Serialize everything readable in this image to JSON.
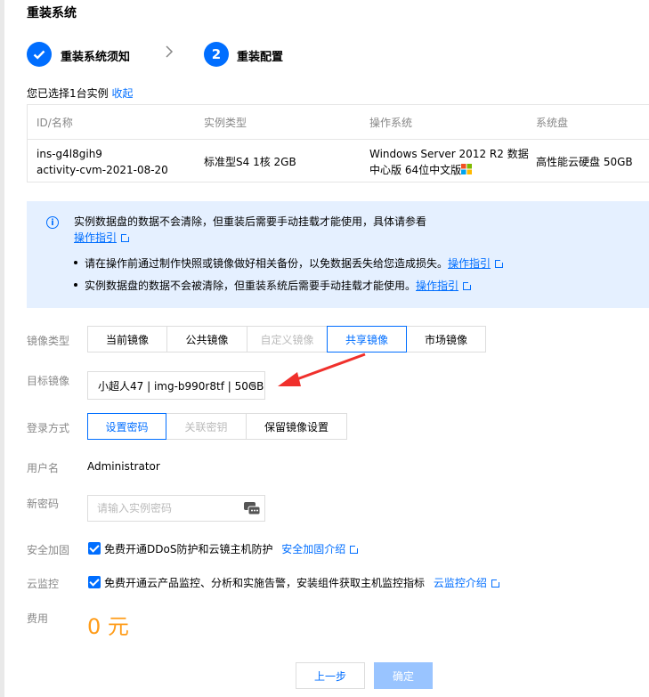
{
  "dialog": {
    "title": "重装系统"
  },
  "steps": [
    {
      "index": "",
      "label": "重装系统须知",
      "state": "done"
    },
    {
      "index": "2",
      "label": "重装配置",
      "state": "current"
    }
  ],
  "selection": {
    "text": "您已选择1台实例",
    "collapse_link": "收起"
  },
  "instance_table": {
    "headers": [
      "ID/名称",
      "实例类型",
      "操作系统",
      "系统盘"
    ],
    "row": {
      "id": "ins-g4l8gih9",
      "name": "activity-cvm-2021-08-20",
      "type": "标准型S4 1核 2GB",
      "os_line1": "Windows Server 2012 R2 数据",
      "os_line2": "中心版 64位中文版",
      "disk": "高性能云硬盘 50GB"
    }
  },
  "notice": {
    "intro": "实例数据盘的数据不会清除，但重装后需要手动挂载才能使用，具体请参看",
    "intro_link": "操作指引",
    "bullet1": "请在操作前通过制作快照或镜像做好相关备份，以免数据丢失给您造成损失。",
    "bullet1_link": "操作指引",
    "bullet2": "实例数据盘的数据不会被清除，但重装系统后需要手动挂载才能使用。",
    "bullet2_link": "操作指引"
  },
  "form": {
    "image_type": {
      "label": "镜像类型",
      "options": [
        "当前镜像",
        "公共镜像",
        "自定义镜像",
        "共享镜像",
        "市场镜像"
      ],
      "selected": "共享镜像"
    },
    "target_image": {
      "label": "目标镜像",
      "value": "小超人47 | img-b990r8tf | 50GB"
    },
    "login_method": {
      "label": "登录方式",
      "options": [
        "设置密码",
        "关联密钥",
        "保留镜像设置"
      ],
      "selected": "设置密码"
    },
    "username": {
      "label": "用户名",
      "value": "Administrator"
    },
    "new_password": {
      "label": "新密码",
      "placeholder": "请输入实例密码"
    },
    "security": {
      "label": "安全加固",
      "text": "免费开通DDoS防护和云镜主机防护",
      "link": "安全加固介绍"
    },
    "monitoring": {
      "label": "云监控",
      "text": "免费开通云产品监控、分析和实施告警，安装组件获取主机监控指标",
      "link": "云监控介绍"
    },
    "fee": {
      "label": "费用",
      "value": "0 元"
    }
  },
  "footer": {
    "prev": "上一步",
    "confirm": "确定"
  },
  "colors": {
    "accent": "#006eff",
    "notice_bg": "#e5f0ff",
    "fee": "#ff9c19",
    "disabled_btn": "#99c4ff"
  }
}
